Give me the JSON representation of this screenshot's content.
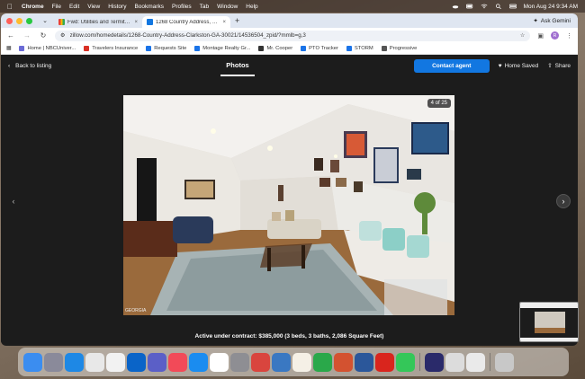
{
  "menubar": {
    "apple": "",
    "items": [
      "Chrome",
      "File",
      "Edit",
      "View",
      "History",
      "Bookmarks",
      "Profiles",
      "Tab",
      "Window",
      "Help"
    ],
    "clock": "Mon Aug 24  9:34 AM"
  },
  "tabs": [
    {
      "title": "Fwd: Utilities and Termite Re...",
      "icon": "gmail-icon"
    },
    {
      "title": "1268 Country Address, Clarks...",
      "icon": "zillow-icon"
    }
  ],
  "tab_close": "×",
  "new_tab": "+",
  "ask_gemini": "Ask Gemini",
  "address": {
    "url": "zillow.com/homedetails/1268-Country-Address-Clarkston-GA-30021/14536504_zpid/?mmlb=g,3",
    "profile_initial": "R"
  },
  "bookmarks": [
    {
      "label": "Home | NBCUniver...",
      "color": "#6b6bd6"
    },
    {
      "label": "Travelers Insurance",
      "color": "#d93025"
    },
    {
      "label": "Requests Site",
      "color": "#1a73e8"
    },
    {
      "label": "Montage Realty Gr...",
      "color": "#1a73e8"
    },
    {
      "label": "Mr. Cooper",
      "color": "#333333"
    },
    {
      "label": "PTO Tracker",
      "color": "#1a73e8"
    },
    {
      "label": "STORM",
      "color": "#1a73e8"
    },
    {
      "label": "Progressive",
      "color": "#555555"
    }
  ],
  "viewer": {
    "back_label": "Back to listing",
    "photos_tab": "Photos",
    "contact_label": "Contact agent",
    "home_saved_label": "Home Saved",
    "share_label": "Share",
    "counter": "4 of 25",
    "watermark": "GEORGIA",
    "caption": "Active under contract: $385,000 (3 beds, 3 baths, 2,086 Square Feet)"
  },
  "colors": {
    "brand_blue": "#1277e1",
    "viewer_bg": "#1c1c1c"
  },
  "dock_apps": [
    {
      "name": "finder",
      "color": "#3b8df0",
      "label": ""
    },
    {
      "name": "launchpad",
      "color": "#8a8a9a",
      "label": ""
    },
    {
      "name": "safari",
      "color": "#1e88e5",
      "label": ""
    },
    {
      "name": "chrome",
      "color": "#e8e8e8",
      "label": ""
    },
    {
      "name": "reminders",
      "color": "#f2f2f2",
      "label": ""
    },
    {
      "name": "outlook",
      "color": "#0a64c8",
      "label": ""
    },
    {
      "name": "teams",
      "color": "#5b5fc7",
      "label": ""
    },
    {
      "name": "news",
      "color": "#f24a58",
      "label": ""
    },
    {
      "name": "app-store",
      "color": "#1a8cf0",
      "label": ""
    },
    {
      "name": "slack",
      "color": "#ffffff",
      "label": ""
    },
    {
      "name": "system-settings",
      "color": "#8e8e93",
      "label": ""
    },
    {
      "name": "word",
      "color": "#d9453e",
      "label": ""
    },
    {
      "name": "photos",
      "color": "#3a78c2",
      "label": ""
    },
    {
      "name": "notes",
      "color": "#f5f0e6",
      "label": ""
    },
    {
      "name": "numbers",
      "color": "#2aa84a",
      "label": ""
    },
    {
      "name": "powerpoint",
      "color": "#d35230",
      "label": ""
    },
    {
      "name": "word-2",
      "color": "#2b579a",
      "label": ""
    },
    {
      "name": "acrobat",
      "color": "#d9251d",
      "label": ""
    },
    {
      "name": "messages",
      "color": "#34c759",
      "label": ""
    },
    {
      "name": "window-1",
      "color": "#2a2a6a",
      "label": ""
    },
    {
      "name": "window-2",
      "color": "#dcdcdc",
      "label": ""
    },
    {
      "name": "window-3",
      "color": "#eaeaea",
      "label": ""
    },
    {
      "name": "trash",
      "color": "#c8c8c8",
      "label": ""
    }
  ]
}
